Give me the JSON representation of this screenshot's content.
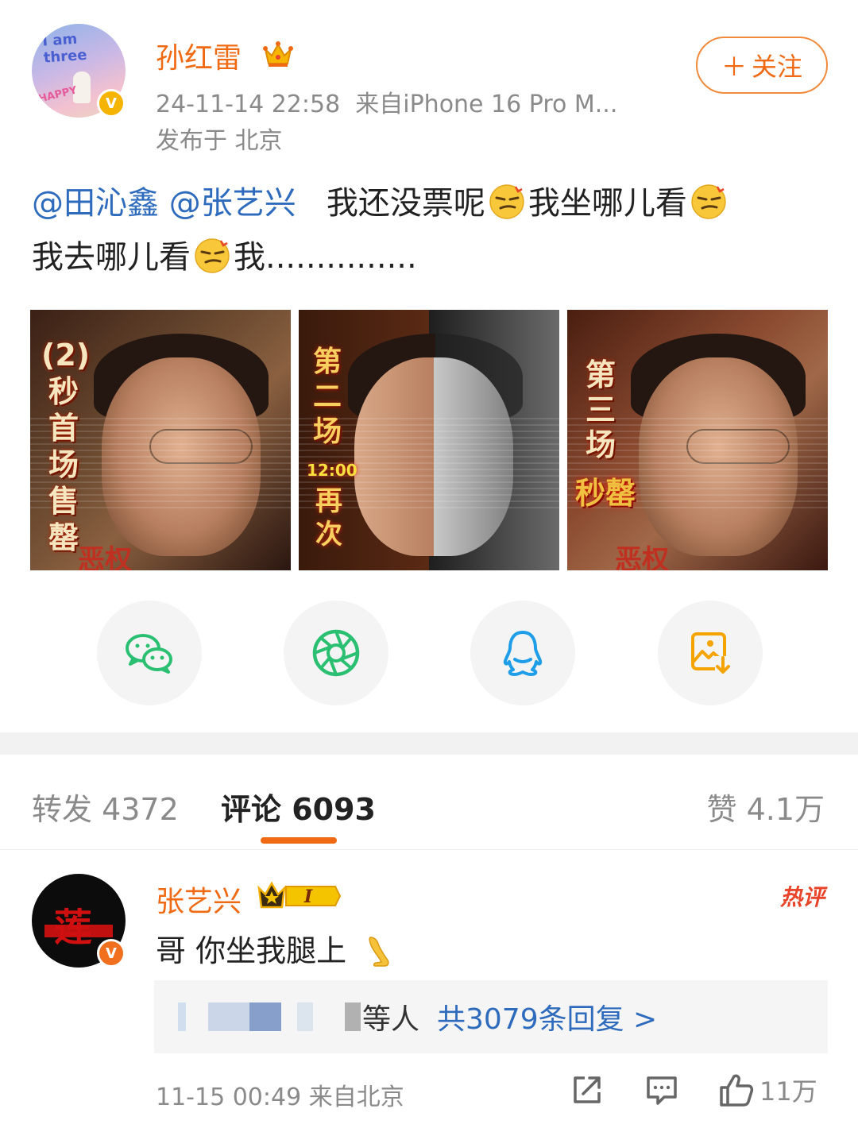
{
  "post": {
    "author": "孙红雷",
    "timestamp": "24-11-14 22:58",
    "source": "来自iPhone 16 Pro M...",
    "location": "发布于 北京",
    "follow_label": "关注",
    "text": {
      "mention_1": "@田沁鑫",
      "mention_2": "@张艺兴",
      "part_1": "我还没票呢",
      "part_2": "我坐哪儿看",
      "part_3": "我去哪儿看",
      "part_4": "我..............."
    },
    "avatar_text": "I am three",
    "avatar_caption": "HAPPY"
  },
  "posters": [
    {
      "title": "(2)秒首场售罄",
      "footer": "恶权"
    },
    {
      "title": "第二场",
      "time": "12:00",
      "title2": "再次"
    },
    {
      "title": "第三场",
      "fire_title": "秒罄",
      "footer": "恶权"
    }
  ],
  "share": [
    {
      "icon": "wechat-icon"
    },
    {
      "icon": "moments-icon"
    },
    {
      "icon": "qq-icon"
    },
    {
      "icon": "save-image-icon"
    }
  ],
  "tabs": {
    "reposts": "转发 4372",
    "comments": "评论 6093",
    "likes": "赞 4.1万"
  },
  "comment": {
    "author": "张艺兴",
    "level": "I",
    "hot_label": "热评",
    "text": "哥 你坐我腿上",
    "reply_suffix": "等人",
    "reply_link": "共3079条回复 >",
    "meta": "11-15 00:49 来自北京",
    "like_count": "11万"
  },
  "colors": {
    "accent": "#f06a14",
    "link": "#2e6bbd",
    "muted": "#8a8a8a"
  }
}
